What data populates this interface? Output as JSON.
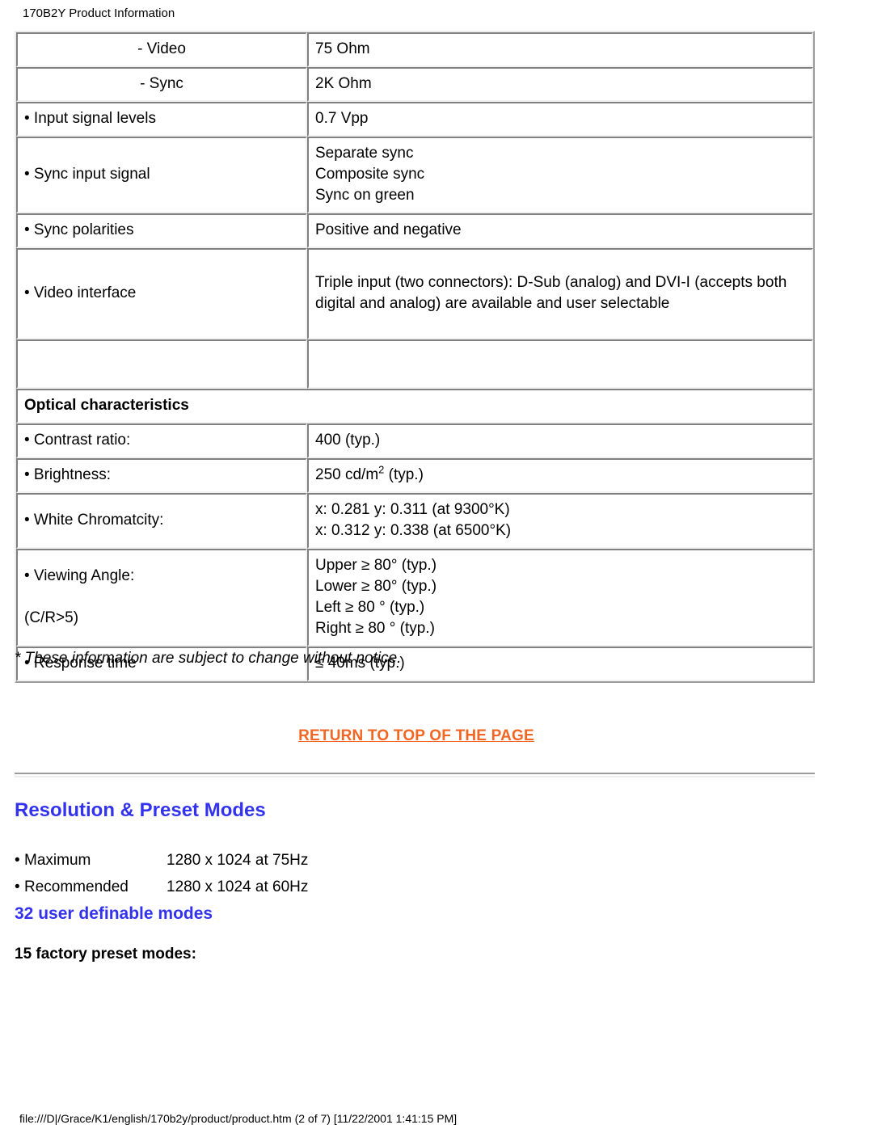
{
  "page": {
    "header_title": "170B2Y Product Information",
    "footer_path": "file:///D|/Grace/K1/english/170b2y/product/product.htm (2 of 7) [11/22/2001 1:41:15 PM]",
    "notice": "* These information are subject to change without notice.",
    "colors": {
      "section_blue": "#3333ee",
      "link_orange": "#f26522",
      "text": "#000000",
      "background": "#ffffff"
    }
  },
  "spec_table": {
    "rows": [
      {
        "kind": "data",
        "align": "center",
        "label": "- Video",
        "value": "75 Ohm"
      },
      {
        "kind": "data",
        "align": "center",
        "label": "- Sync",
        "value": "2K Ohm"
      },
      {
        "kind": "data",
        "align": "left",
        "label": "• Input signal levels",
        "value": "0.7 Vpp"
      },
      {
        "kind": "data",
        "align": "left",
        "label": "• Sync input signal",
        "value": "Separate sync\nComposite sync\nSync on green"
      },
      {
        "kind": "data",
        "align": "left",
        "label": "• Sync polarities",
        "value": "Positive and negative"
      },
      {
        "kind": "data",
        "align": "left",
        "label": "• Video interface",
        "value": "Triple input (two connectors): D-Sub (analog) and DVI-I (accepts both digital and analog) are available and user selectable"
      },
      {
        "kind": "blank",
        "align": "left",
        "label": "",
        "value": ""
      },
      {
        "kind": "section",
        "label": "Optical characteristics"
      },
      {
        "kind": "data",
        "align": "left",
        "label": "• Contrast ratio:",
        "value": "400 (typ.)"
      },
      {
        "kind": "data",
        "align": "left",
        "label": "• Brightness:",
        "value_html": "250 cd/m<sup>2</sup> (typ.)",
        "value": "250 cd/m2 (typ.)"
      },
      {
        "kind": "data",
        "align": "left",
        "label": "• White Chromatcity:",
        "value": "x: 0.281 y: 0.311 (at 9300°K)\nx: 0.312 y: 0.338 (at 6500°K)"
      },
      {
        "kind": "data",
        "align": "left",
        "label": "• Viewing Angle:\n\n(C/R>5)",
        "value": "Upper ≥ 80° (typ.)\nLower ≥ 80° (typ.)\nLeft ≥ 80 ° (typ.)\nRight ≥ 80 ° (typ.)"
      },
      {
        "kind": "data",
        "align": "left",
        "label": "• Response time",
        "value": "≤ 40ms (typ.)"
      }
    ]
  },
  "return_link": {
    "label": "RETURN TO TOP OF THE PAGE"
  },
  "resolution": {
    "title": "Resolution & Preset Modes",
    "items": [
      {
        "bullet": "•",
        "name": "Maximum",
        "value": "1280 x 1024 at 75Hz"
      },
      {
        "bullet": "•",
        "name": "Recommended",
        "value": "1280 x 1024 at 60Hz"
      }
    ],
    "user_modes": "32 user definable modes",
    "factory_modes_label": "15 factory preset modes:"
  }
}
